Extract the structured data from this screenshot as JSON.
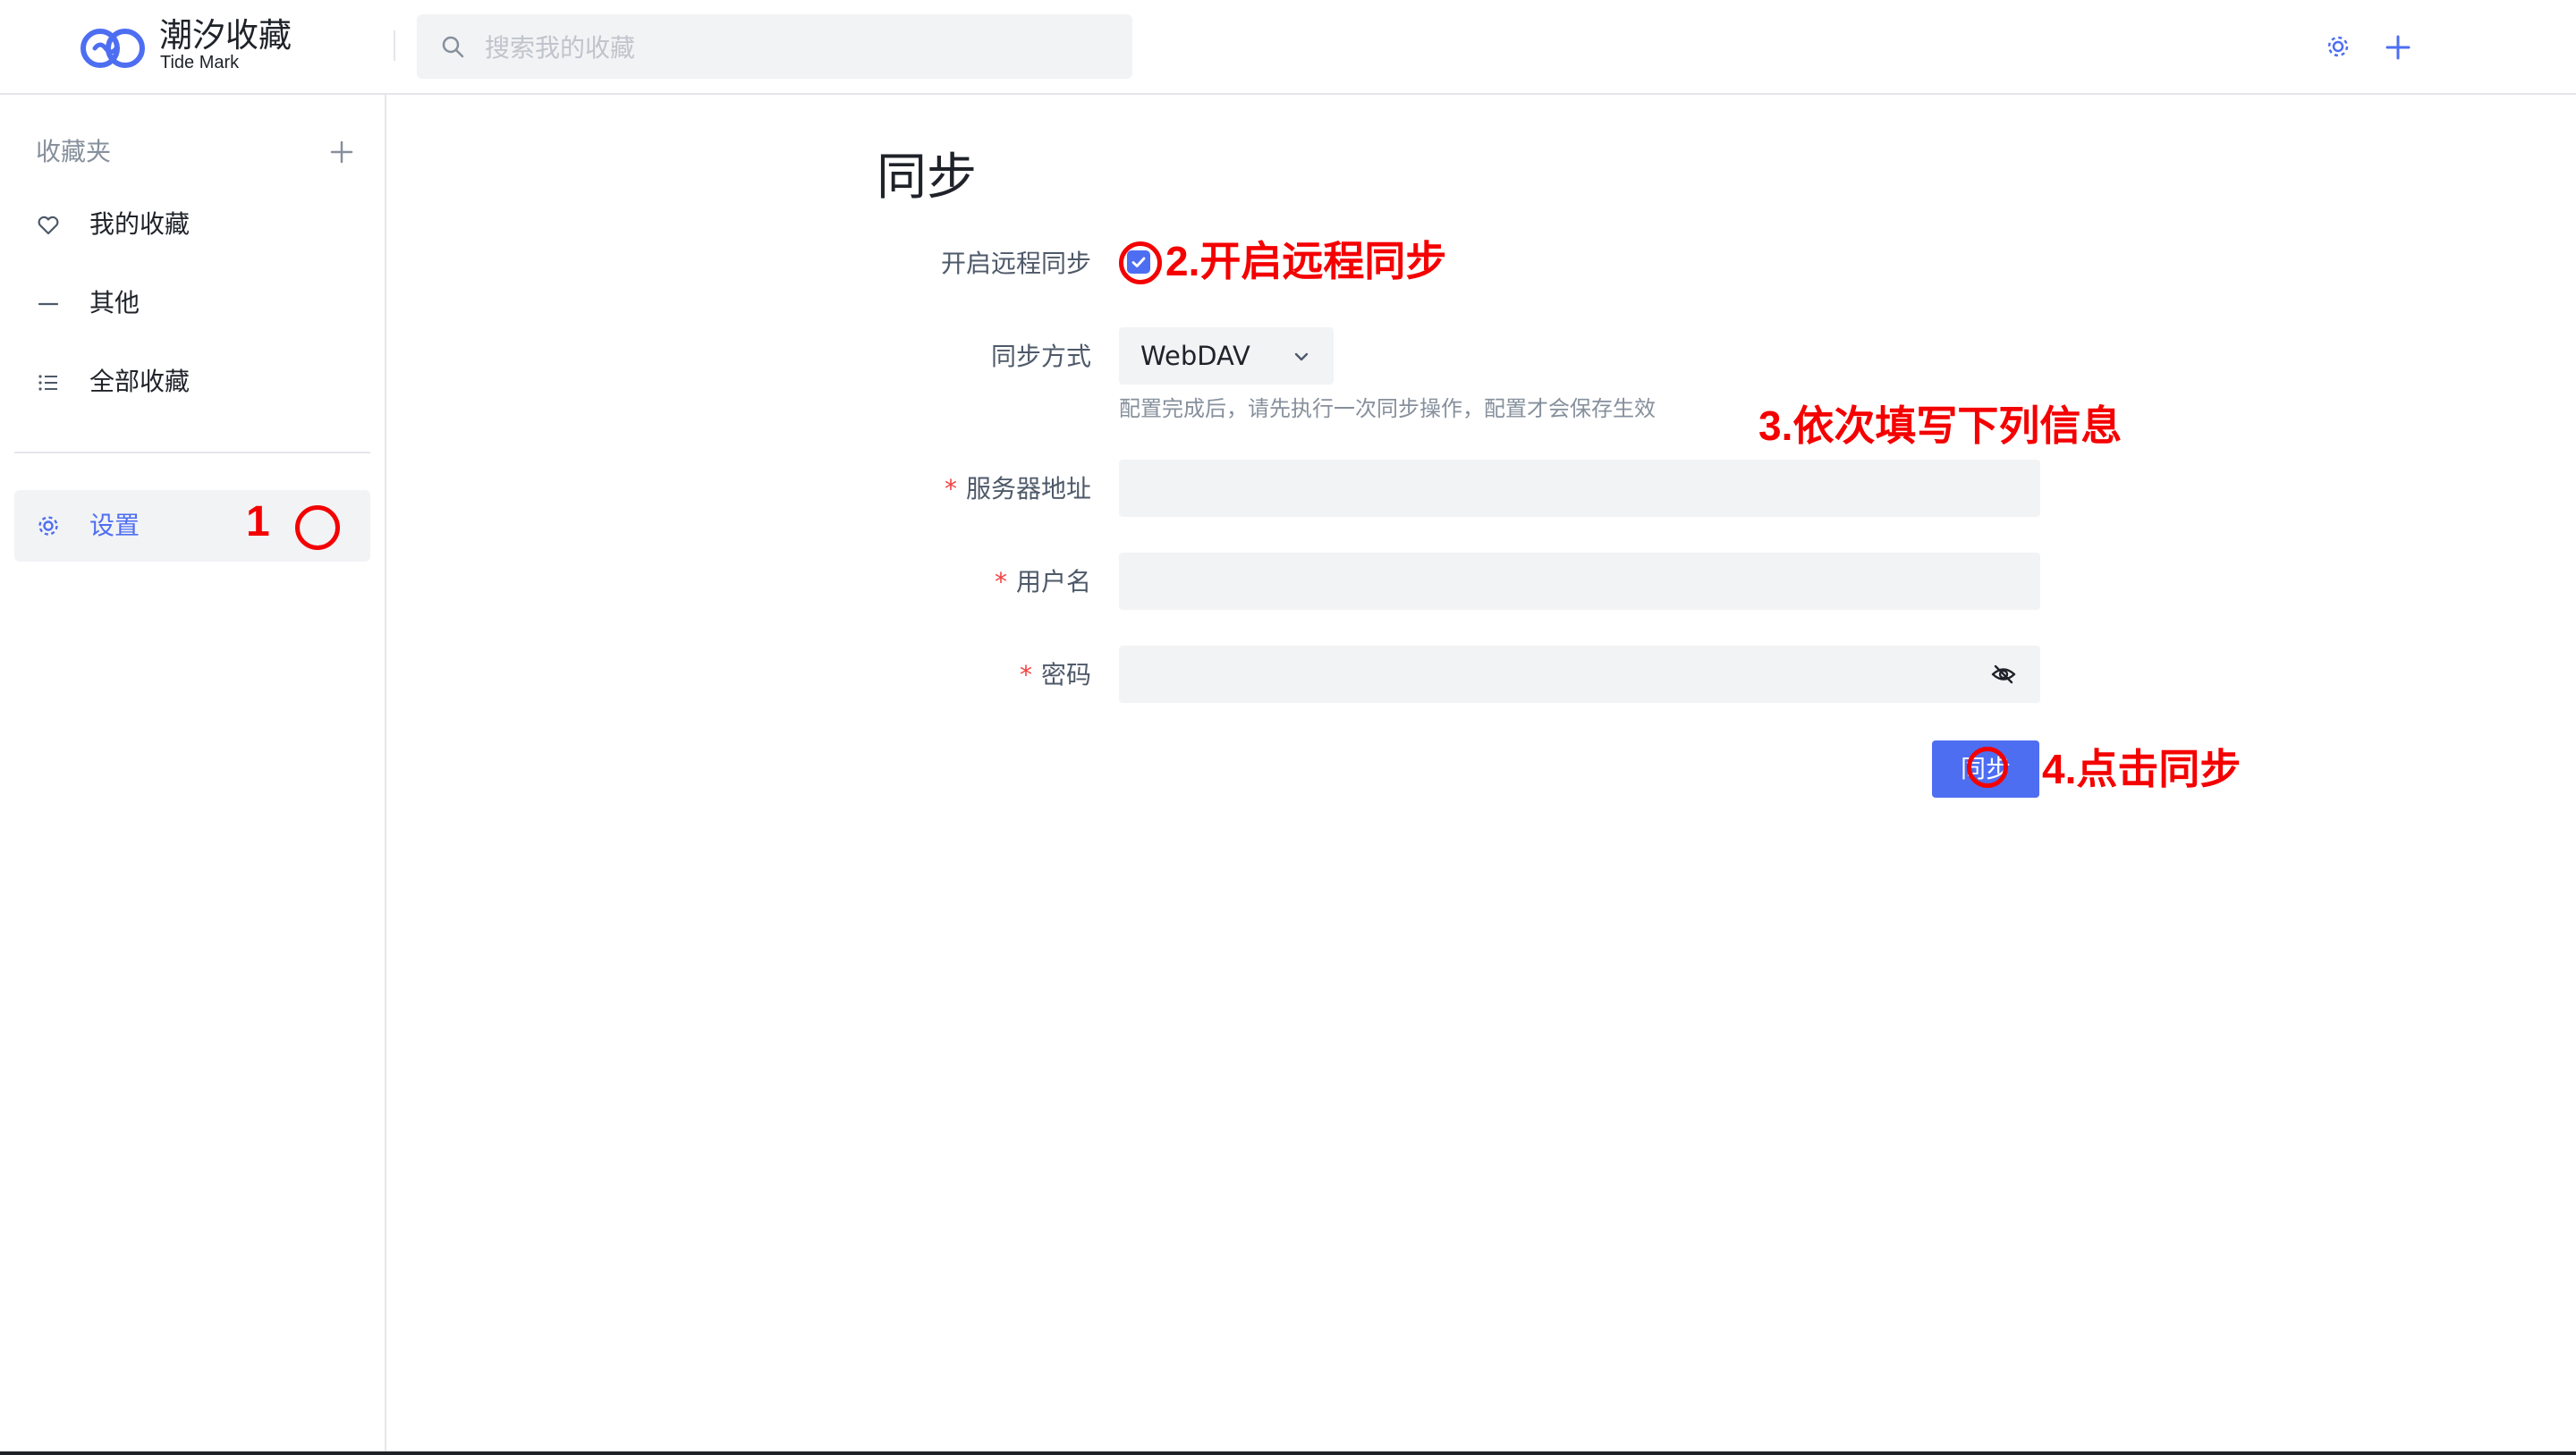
{
  "header": {
    "app_title": "潮汐收藏",
    "app_subtitle": "Tide Mark",
    "search_placeholder": "搜索我的收藏",
    "settings_icon": "gear-icon",
    "add_icon": "plus-icon"
  },
  "sidebar": {
    "heading": "收藏夹",
    "items": [
      {
        "label": "我的收藏",
        "icon": "heart-icon"
      },
      {
        "label": "其他",
        "icon": "dash-icon"
      },
      {
        "label": "全部收藏",
        "icon": "list-icon"
      }
    ],
    "settings_label": "设置"
  },
  "main": {
    "title": "同步",
    "remote_sync_label": "开启远程同步",
    "remote_sync_enabled": true,
    "sync_method_label": "同步方式",
    "sync_method_value": "WebDAV",
    "hint": "配置完成后，请先执行一次同步操作，配置才会保存生效",
    "server_label": "服务器地址",
    "username_label": "用户名",
    "password_label": "密码",
    "required_mark": "*",
    "sync_button": "同步"
  },
  "annotations": {
    "step1": "1",
    "step2": "2.开启远程同步",
    "step3": "3.依次填写下列信息",
    "step4": "4.点击同步",
    "color": "#f50000"
  },
  "colors": {
    "accent": "#4e6ef2",
    "surface": "#f2f3f5",
    "border": "#e5e6eb"
  }
}
